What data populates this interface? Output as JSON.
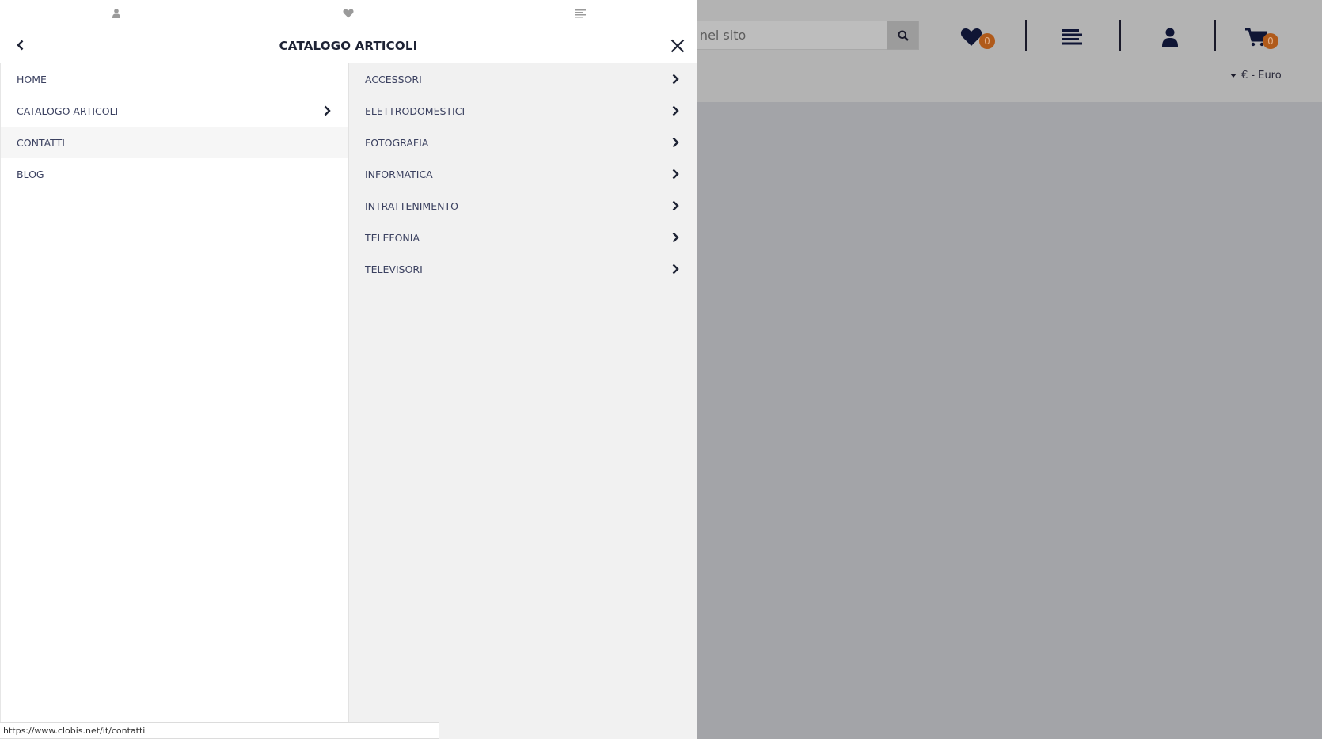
{
  "drawer": {
    "title": "CATALOGO ARTICOLI",
    "tabs": [
      {
        "icon": "user-icon"
      },
      {
        "icon": "heart-icon"
      },
      {
        "icon": "menu-icon"
      }
    ],
    "main_menu": [
      {
        "label": "HOME",
        "has_children": false
      },
      {
        "label": "CATALOGO ARTICOLI",
        "has_children": true
      },
      {
        "label": "CONTATTI",
        "has_children": false
      },
      {
        "label": "BLOG",
        "has_children": false
      }
    ],
    "submenu": [
      {
        "label": "ACCESSORI"
      },
      {
        "label": "ELETTRODOMESTICI"
      },
      {
        "label": "FOTOGRAFIA"
      },
      {
        "label": "INFORMATICA"
      },
      {
        "label": "INTRATTENIMENTO"
      },
      {
        "label": "TELEFONIA"
      },
      {
        "label": "TELEVISORI"
      }
    ]
  },
  "header": {
    "search_text": "e nel sito",
    "wishlist_count": "0",
    "cart_count": "0",
    "currency": "€ - Euro"
  },
  "status_bar": {
    "url": "https://www.clobis.net/it/contatti"
  },
  "colors": {
    "accent_badge": "#b05a1a",
    "text_dark": "#1e2335",
    "menu_text": "#3b4160"
  }
}
